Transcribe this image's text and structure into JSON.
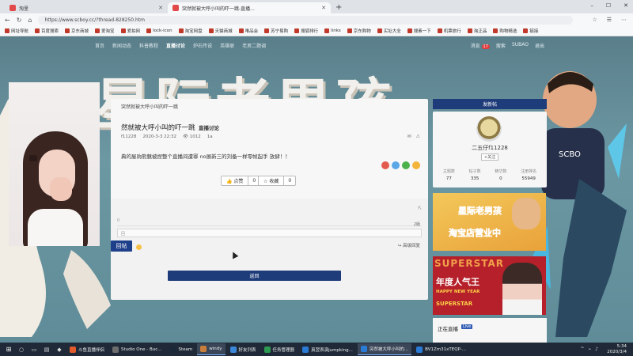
{
  "browser": {
    "tabs": [
      {
        "label": "淘里",
        "active": false
      },
      {
        "label": "突然就被大呼小叫的吓一跳-直播...",
        "active": true
      }
    ],
    "new_tab": "+",
    "url": "https://www.scboy.cc/?thread-828250.htm",
    "window_controls": [
      "–",
      "☐",
      "✕"
    ]
  },
  "bookmarks": [
    "网址导航",
    "百度搜索",
    "京东商城",
    "爱淘宝",
    "爱拍网",
    "lock-icon",
    "淘宝网盘",
    "天猫商城",
    "唯品会",
    "苏宁易购",
    "搜狐排行",
    "links",
    "京东购物",
    "买址大全",
    "搜素一下",
    "机票旅行",
    "淘正品",
    "购物精选",
    "链接"
  ],
  "site": {
    "banner_title": "星际老男孩",
    "nav": [
      "首页",
      "新闻动态",
      "科普教程",
      "直播讨论",
      "炉石传说",
      "英雄联",
      "老男二题调"
    ],
    "active_nav": "直播讨论",
    "userbar": {
      "notice_label": "消息",
      "notice_count": "17",
      "search_label": "搜索",
      "user": "SUBAO",
      "logout": "退出"
    }
  },
  "post": {
    "breadcrumb": "突然就被大呼小叫的吓一跳",
    "title": "然就被大呼小叫的吓一跳",
    "tag": "直播讨论",
    "author": "f11228",
    "datetime": "2020-3-3 22:32",
    "views": "1012",
    "replies_label": "1a",
    "body": "典的屋驹熊魅被捏整个直播间遭罪 no展新三的刘备一样零帧起手 放肆！！",
    "like_label": "点赞",
    "like_count": "0",
    "fav_label": "收藏",
    "fav_count": "0"
  },
  "reply": {
    "field_label": "0",
    "count": "2版",
    "hint": "回",
    "submit_label": "回帖",
    "advanced_label": "高级回复",
    "back_label": "返回"
  },
  "sidebar": {
    "header": "发新帖",
    "username": "二五仔f11228",
    "follow_label": "+关注",
    "stats": [
      {
        "key": "主题数",
        "value": "77"
      },
      {
        "key": "帖子数",
        "value": "335"
      },
      {
        "key": "精华数",
        "value": "0"
      },
      {
        "key": "注册排名",
        "value": "55949"
      }
    ],
    "banner1_line1": "星际老男孩",
    "banner1_line2": "淘宝店营业中",
    "banner2_line1": "SUPERSTAR",
    "banner2_line2": "年度人气王",
    "banner2_line3": "HAPPY NEW YEAR",
    "banner2_line4": "SUPERSTAR",
    "live_title": "正在直播",
    "live_badge": "Live"
  },
  "taskbar": {
    "apps": [
      {
        "label": "斗鱼直播伴侣",
        "color": "#e35a2b",
        "active": false
      },
      {
        "label": "Studio One - Buc...",
        "color": "#6d6d6d",
        "active": false
      },
      {
        "label": "Steam",
        "color": "#1b2838",
        "active": false
      },
      {
        "label": "windy",
        "color": "#c87e3a",
        "active": true
      },
      {
        "label": "好友列表",
        "color": "#3a86d9",
        "active": false
      },
      {
        "label": "任务管理器",
        "color": "#2d9a52",
        "active": false
      },
      {
        "label": "真翌表演jumpking...",
        "color": "#2a7bd6",
        "active": false
      },
      {
        "label": "突然被大呼小叫的...",
        "color": "#2a7bd6",
        "active": true
      },
      {
        "label": "BV1Zm31xTEQP-...",
        "color": "#2a7bd6",
        "active": false
      }
    ],
    "time": "5:34",
    "date": "2020/3/4"
  }
}
